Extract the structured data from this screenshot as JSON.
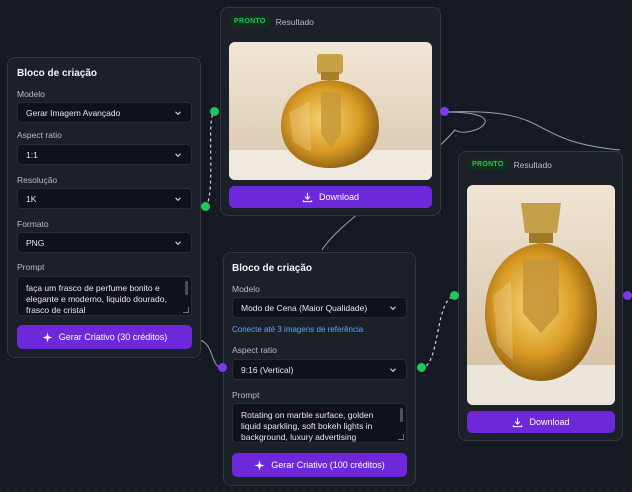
{
  "nodes": {
    "creation_block_1": {
      "title": "Bloco de criação",
      "model_label": "Modelo",
      "model_value": "Gerar Imagem Avançado",
      "aspect_label": "Aspect ratio",
      "aspect_value": "1:1",
      "resolution_label": "Resolução",
      "resolution_value": "1K",
      "format_label": "Formato",
      "format_value": "PNG",
      "prompt_label": "Prompt",
      "prompt_text": "faça um frasco de perfume bonito e elegante e moderno, liquido dourado, frasco de cristal",
      "generate_label": "Gerar Criativo (30 créditos)"
    },
    "result_1": {
      "badge": "PRONTO",
      "title": "Resultado",
      "download_label": "Download"
    },
    "result_2": {
      "badge": "PRONTO",
      "title": "Resultado",
      "download_label": "Download"
    },
    "creation_block_2": {
      "title": "Bloco de criação",
      "model_label": "Modelo",
      "model_value": "Modo de Cena (Maior Qualidade)",
      "reference_link": "Conecte até 3 imagens de referência",
      "aspect_label": "Aspect ratio",
      "aspect_value": "9:16 (Vertical)",
      "prompt_label": "Prompt",
      "prompt_text": "Rotating on marble surface, golden liquid sparkling, soft bokeh lights in background, luxury advertising",
      "generate_label": "Gerar Criativo (100 créditos)"
    }
  },
  "icons": {
    "chevron": "chevron-down-icon",
    "download": "download-icon",
    "sparkle": "sparkle-icon"
  },
  "colors": {
    "accent": "#6d28d9",
    "ready": "#22c55e",
    "link": "#60a5fa",
    "background": "#151922",
    "card": "#1b2029"
  }
}
